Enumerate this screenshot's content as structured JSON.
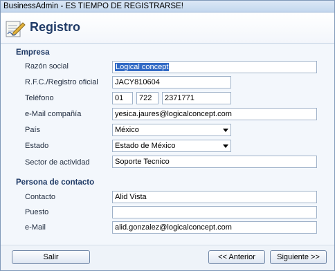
{
  "window": {
    "title": "BusinessAdmin - ES TIEMPO DE REGISTRARSE!"
  },
  "header": {
    "title": "Registro",
    "icon": "registration-form-icon"
  },
  "empresa": {
    "section": "Empresa",
    "razon_social_label": "Razón social",
    "razon_social": "Logical concept",
    "rfc_label": "R.F.C./Registro oficial",
    "rfc": "JACY810604",
    "telefono_label": "Teléfono",
    "tel_lada": "01",
    "tel_area": "722",
    "tel_num": "2371771",
    "email_label": "e-Mail compañía",
    "email": "yesica.jaures@logicalconcept.com",
    "pais_label": "País",
    "pais": "México",
    "estado_label": "Estado",
    "estado": "Estado de México",
    "sector_label": "Sector de actividad",
    "sector": "Soporte Tecnico"
  },
  "contacto": {
    "section": "Persona de contacto",
    "contacto_label": "Contacto",
    "contacto": "Alid Vista",
    "puesto_label": "Puesto",
    "puesto": "",
    "email_label": "e-Mail",
    "email": "alid.gonzalez@logicalconcept.com"
  },
  "footer": {
    "salir": "Salir",
    "anterior": "<< Anterior",
    "siguiente": "Siguiente >>"
  }
}
